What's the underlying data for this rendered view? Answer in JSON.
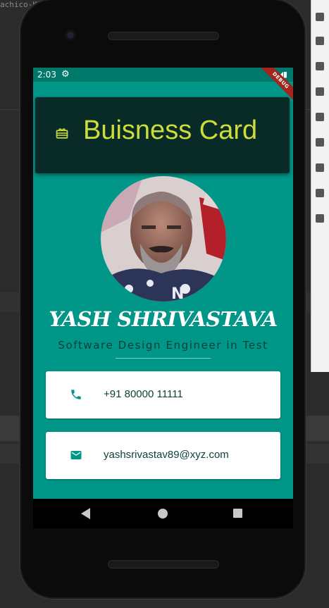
{
  "ide": {
    "tab_fragment": "achico-Ke"
  },
  "status_bar": {
    "time": "2:03",
    "settings_icon": "gear-icon",
    "indicators": "▼◢▮",
    "debug_label": "DEBUG"
  },
  "header": {
    "icon": "card-giftcard-icon",
    "title": "Buisness Card"
  },
  "profile": {
    "name": "YASH SHRIVASTAVA",
    "title": "Software Design Engineer in Test"
  },
  "contacts": {
    "phone": {
      "icon": "phone-icon",
      "value": "+91 80000 11111"
    },
    "email": {
      "icon": "email-icon",
      "value": "yashsrivastav89@xyz.com"
    }
  },
  "colors": {
    "background_teal": "#009688",
    "status_bar": "#00796b",
    "header_bg": "#082b28",
    "header_text": "#cddc39",
    "icon_teal": "#009688",
    "contact_text": "#0a3f3a"
  }
}
